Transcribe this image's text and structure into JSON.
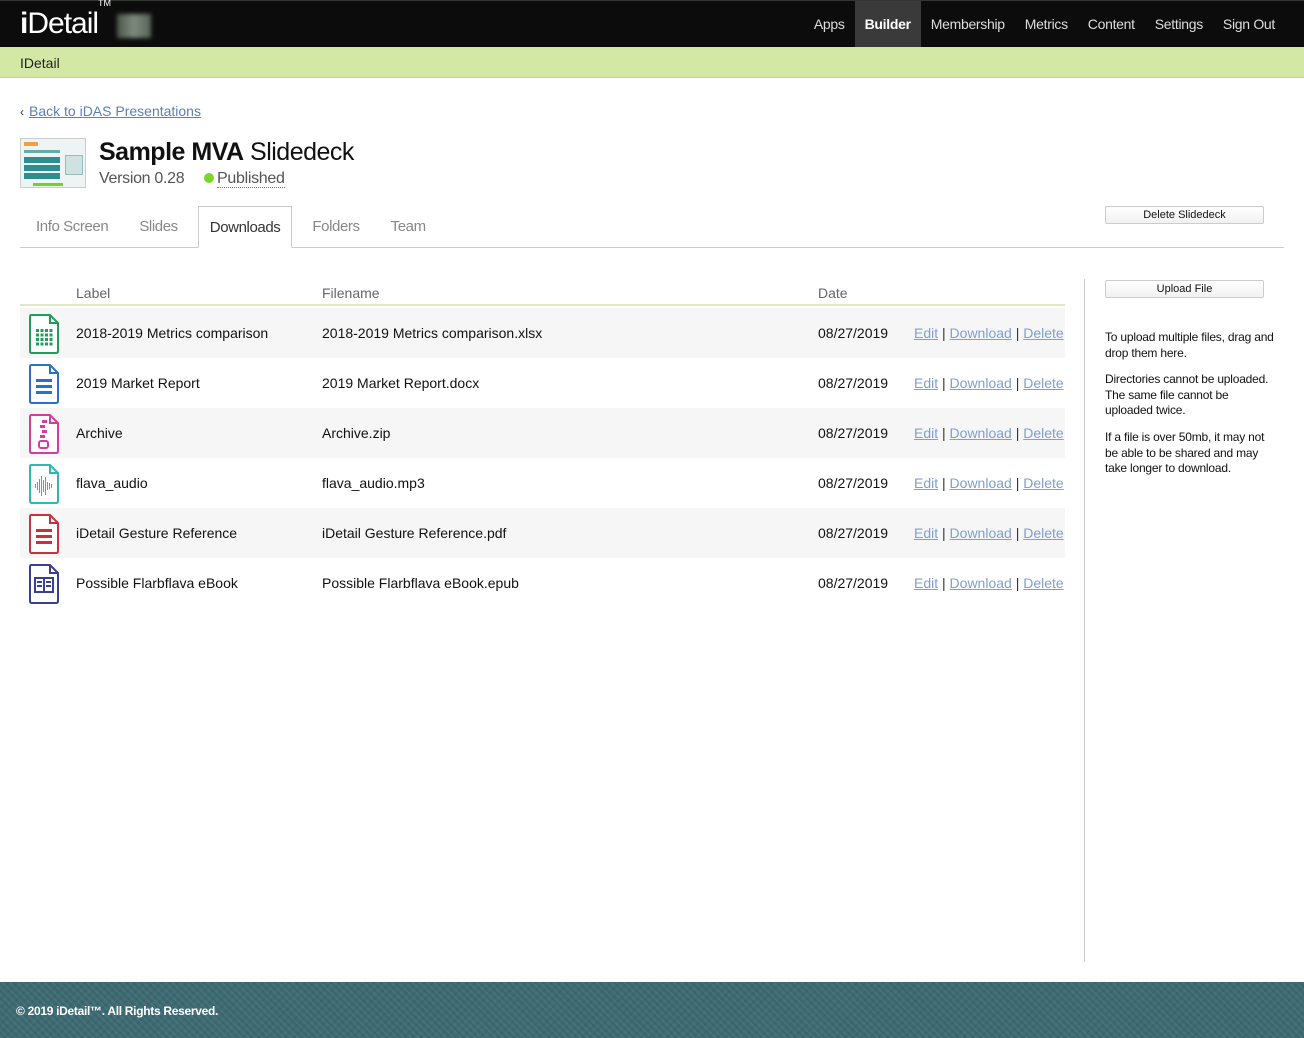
{
  "app": {
    "logo_prefix": "i",
    "logo_text": "Detail",
    "logo_tm": "TM"
  },
  "nav": {
    "items": [
      "Apps",
      "Builder",
      "Membership",
      "Metrics",
      "Content",
      "Settings",
      "Sign Out"
    ],
    "active": "Builder"
  },
  "subbar": {
    "label": "IDetail"
  },
  "back_link": {
    "label": "Back to iDAS Presentations"
  },
  "deck": {
    "title_bold": "Sample MVA",
    "title_rest": " Slidedeck",
    "version": "Version 0.28",
    "status": "Published",
    "status_color": "#7cd62a"
  },
  "tabs": [
    "Info Screen",
    "Slides",
    "Downloads",
    "Folders",
    "Team"
  ],
  "active_tab": "Downloads",
  "buttons": {
    "delete": "Delete Slidedeck",
    "upload": "Upload File"
  },
  "help": {
    "p1": "To upload multiple files, drag and drop them here.",
    "p2": "Directories cannot be uploaded. The same file cannot be uploaded twice.",
    "p3": "If a file is over 50mb, it may not be able to be shared and may take longer to download."
  },
  "table": {
    "headers": {
      "label": "Label",
      "filename": "Filename",
      "date": "Date"
    },
    "actions": {
      "edit": "Edit",
      "download": "Download",
      "delete": "Delete",
      "sep": "|"
    },
    "rows": [
      {
        "label": "2018-2019 Metrics comparison",
        "filename": "2018-2019 Metrics comparison.xlsx",
        "date": "08/27/2019",
        "icon": "spreadsheet-file-icon",
        "color": "#1e9e5a"
      },
      {
        "label": "2019 Market Report",
        "filename": "2019 Market Report.docx",
        "date": "08/27/2019",
        "icon": "document-file-icon",
        "color": "#2a72c2"
      },
      {
        "label": "Archive",
        "filename": "Archive.zip",
        "date": "08/27/2019",
        "icon": "zip-file-icon",
        "color": "#d63ba0"
      },
      {
        "label": "flava_audio",
        "filename": "flava_audio.mp3",
        "date": "08/27/2019",
        "icon": "audio-file-icon",
        "color": "#2fb7b3"
      },
      {
        "label": "iDetail Gesture Reference",
        "filename": "iDetail Gesture Reference.pdf",
        "date": "08/27/2019",
        "icon": "pdf-file-icon",
        "color": "#c8323c"
      },
      {
        "label": "Possible Flarbflava eBook",
        "filename": "Possible Flarbflava eBook.epub",
        "date": "08/27/2019",
        "icon": "ebook-file-icon",
        "color": "#3a3f8f"
      }
    ]
  },
  "footer": {
    "text": "© 2019 iDetail™.  All Rights Reserved."
  }
}
